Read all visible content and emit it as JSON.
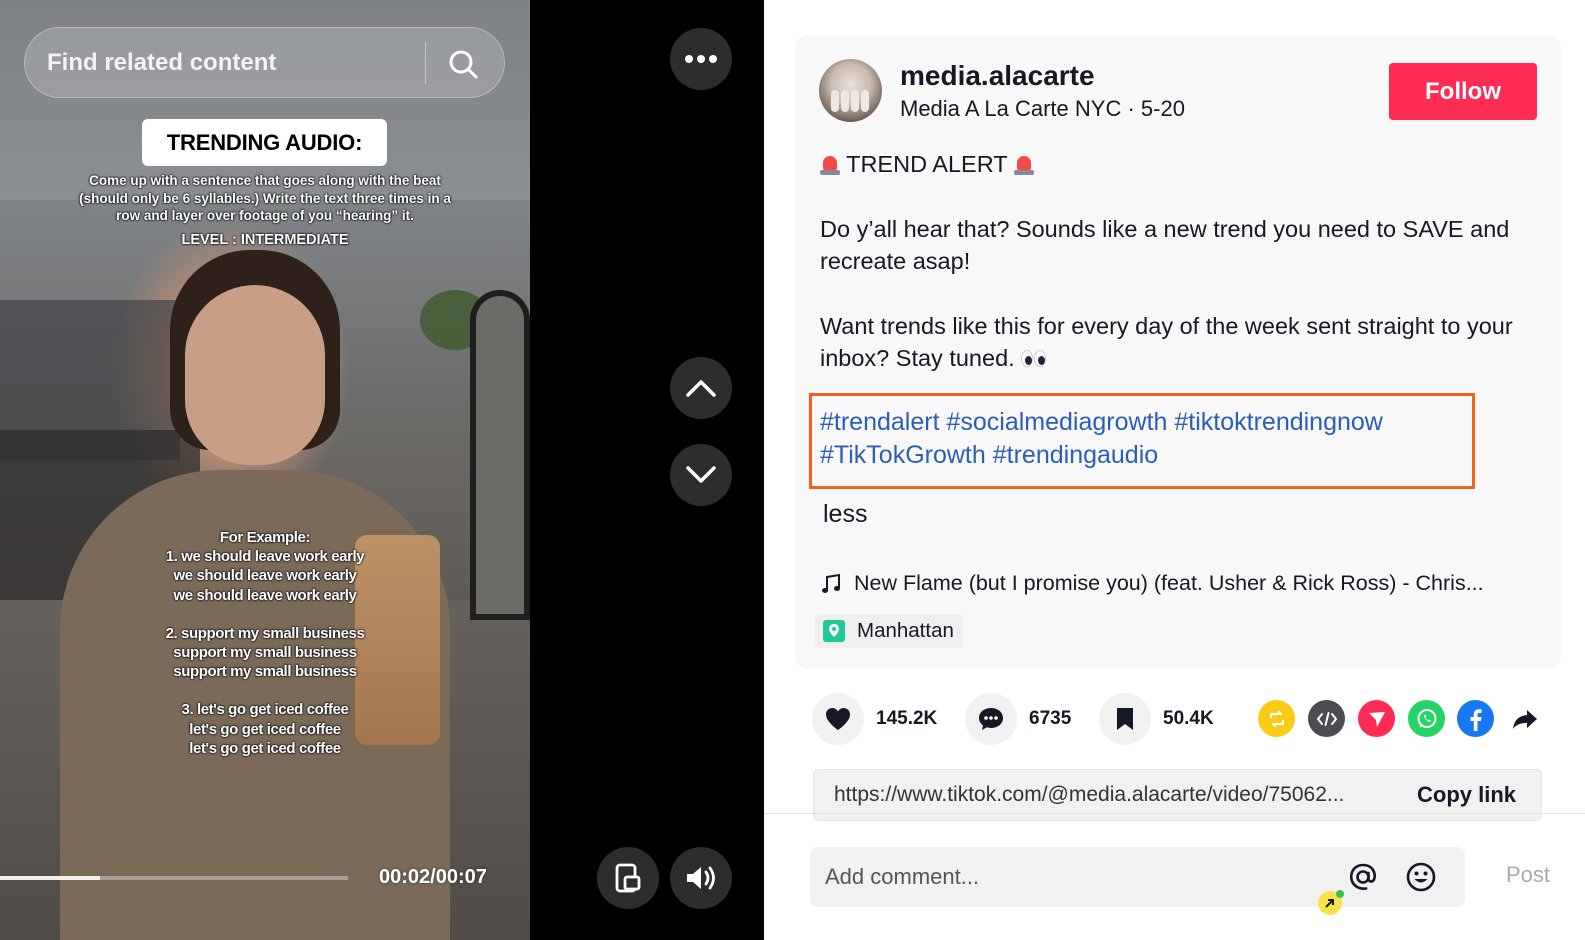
{
  "video": {
    "search_placeholder": "Find related content",
    "overlay_title": "TRENDING AUDIO:",
    "overlay_description_lines": [
      "Come up with a sentence that goes along with the beat",
      "(should only be 6 syllables.) Write the text three times in a",
      "row and layer over footage of you “hearing” it."
    ],
    "overlay_level": "LEVEL : INTERMEDIATE",
    "example_heading": "For Example:",
    "example_lines": [
      "1. we should leave work early",
      "we should leave work early",
      "we should leave work early",
      "",
      "2. support my small business",
      "support my small business",
      "support my small business",
      "",
      "3. let's go get iced coffee",
      "let's go get iced coffee",
      "let's go get iced coffee"
    ],
    "time_display": "00:02/00:07",
    "progress_fraction": 0.286
  },
  "controls": {
    "more_icon": "more-dots-icon",
    "prev_icon": "chevron-up-icon",
    "next_icon": "chevron-down-icon",
    "floating_player_icon": "floating-player-icon",
    "volume_icon": "volume-icon"
  },
  "post": {
    "username": "media.alacarte",
    "display_name": "Media A La Carte NYC",
    "separator": " · ",
    "date": "5-20",
    "follow_label": "Follow",
    "caption_alert": "TREND ALERT",
    "caption_para1": "Do y’all hear that? Sounds like a new trend you need to SAVE and recreate asap!",
    "caption_para2": "Want trends like this for every day of the week sent straight to your inbox? Stay tuned.",
    "hashtags": [
      "#trendalert",
      "#socialmediagrowth",
      "#tiktoktrendingnow",
      "#TikTokGrowth",
      "#trendingaudio"
    ],
    "less_label": "less",
    "music": "New Flame (but I promise you) (feat. Usher & Rick Ross) - Chris...",
    "location": "Manhattan",
    "likes": "145.2K",
    "comments": "6735",
    "saves": "50.4K",
    "share_icons": [
      "repost-icon",
      "embed-icon",
      "send-icon",
      "whatsapp-icon",
      "facebook-icon",
      "share-arrow-icon"
    ],
    "url": "https://www.tiktok.com/@media.alacarte/video/75062...",
    "copy_link_label": "Copy link",
    "comment_placeholder": "Add comment...",
    "post_label": "Post"
  },
  "colors": {
    "follow_red": "#fe2c55",
    "hashtag_blue": "#2b5db9",
    "highlight_orange": "#f0631c"
  }
}
